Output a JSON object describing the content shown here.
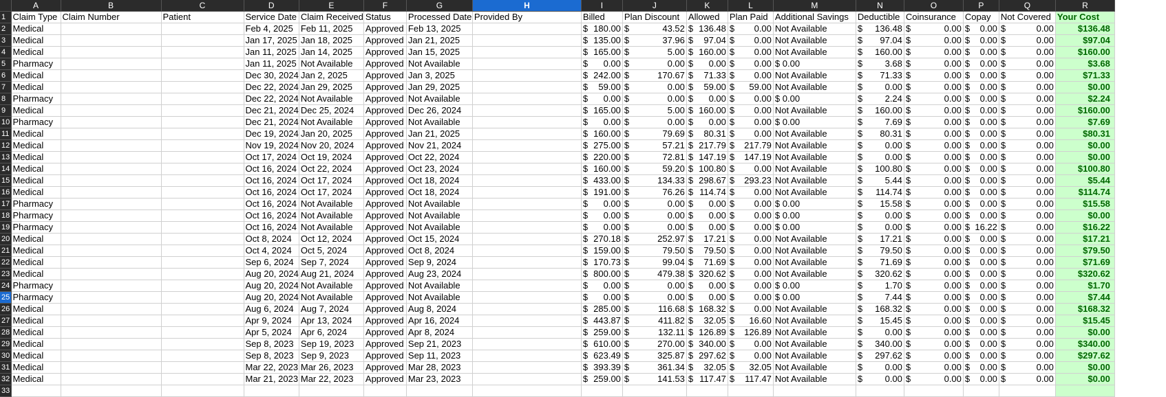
{
  "columns": [
    {
      "letter": "A",
      "header": "Claim Type"
    },
    {
      "letter": "B",
      "header": "Claim Number"
    },
    {
      "letter": "C",
      "header": "Patient"
    },
    {
      "letter": "D",
      "header": "Service Date"
    },
    {
      "letter": "E",
      "header": "Claim Received"
    },
    {
      "letter": "F",
      "header": "Status"
    },
    {
      "letter": "G",
      "header": "Processed Date"
    },
    {
      "letter": "H",
      "header": "Provided By"
    },
    {
      "letter": "I",
      "header": "Billed"
    },
    {
      "letter": "J",
      "header": "Plan Discount"
    },
    {
      "letter": "K",
      "header": "Allowed"
    },
    {
      "letter": "L",
      "header": "Plan Paid"
    },
    {
      "letter": "M",
      "header": "Additional Savings"
    },
    {
      "letter": "N",
      "header": "Deductible"
    },
    {
      "letter": "O",
      "header": "Coinsurance"
    },
    {
      "letter": "P",
      "header": "Copay"
    },
    {
      "letter": "Q",
      "header": "Not Covered"
    },
    {
      "letter": "R",
      "header": "Your Cost"
    }
  ],
  "selected_column": "H",
  "currency_symbol": "$",
  "rows": [
    [
      "2",
      "Medical",
      "",
      "",
      "Feb 4, 2025",
      "Feb 11, 2025",
      "Approved",
      "Feb 13, 2025",
      "",
      "180.00",
      "43.52",
      "136.48",
      "0.00",
      "Not Available",
      "136.48",
      "0.00",
      "0.00",
      "0.00",
      "$136.48"
    ],
    [
      "3",
      "Medical",
      "",
      "",
      "Jan 17, 2025",
      "Jan 18, 2025",
      "Approved",
      "Jan 21, 2025",
      "",
      "135.00",
      "37.96",
      "97.04",
      "0.00",
      "Not Available",
      "97.04",
      "0.00",
      "0.00",
      "0.00",
      "$97.04"
    ],
    [
      "4",
      "Medical",
      "",
      "",
      "Jan 11, 2025",
      "Jan 14, 2025",
      "Approved",
      "Jan 15, 2025",
      "",
      "165.00",
      "5.00",
      "160.00",
      "0.00",
      "Not Available",
      "160.00",
      "0.00",
      "0.00",
      "0.00",
      "$160.00"
    ],
    [
      "5",
      "Pharmacy",
      "",
      "",
      "Jan 11, 2025",
      "Not Available",
      "Approved",
      "Not Available",
      "",
      "0.00",
      "0.00",
      "0.00",
      "0.00",
      "$ 0.00",
      "3.68",
      "0.00",
      "0.00",
      "0.00",
      "$3.68"
    ],
    [
      "6",
      "Medical",
      "",
      "",
      "Dec 30, 2024",
      "Jan 2, 2025",
      "Approved",
      "Jan 3, 2025",
      "",
      "242.00",
      "170.67",
      "71.33",
      "0.00",
      "Not Available",
      "71.33",
      "0.00",
      "0.00",
      "0.00",
      "$71.33"
    ],
    [
      "7",
      "Medical",
      "",
      "",
      "Dec 22, 2024",
      "Jan 29, 2025",
      "Approved",
      "Jan 29, 2025",
      "",
      "59.00",
      "0.00",
      "59.00",
      "59.00",
      "Not Available",
      "0.00",
      "0.00",
      "0.00",
      "0.00",
      "$0.00"
    ],
    [
      "8",
      "Pharmacy",
      "",
      "",
      "Dec 22, 2024",
      "Not Available",
      "Approved",
      "Not Available",
      "",
      "0.00",
      "0.00",
      "0.00",
      "0.00",
      "$ 0.00",
      "2.24",
      "0.00",
      "0.00",
      "0.00",
      "$2.24"
    ],
    [
      "9",
      "Medical",
      "",
      "",
      "Dec 21, 2024",
      "Dec 25, 2024",
      "Approved",
      "Dec 26, 2024",
      "",
      "165.00",
      "5.00",
      "160.00",
      "0.00",
      "Not Available",
      "160.00",
      "0.00",
      "0.00",
      "0.00",
      "$160.00"
    ],
    [
      "10",
      "Pharmacy",
      "",
      "",
      "Dec 21, 2024",
      "Not Available",
      "Approved",
      "Not Available",
      "",
      "0.00",
      "0.00",
      "0.00",
      "0.00",
      "$ 0.00",
      "7.69",
      "0.00",
      "0.00",
      "0.00",
      "$7.69"
    ],
    [
      "11",
      "Medical",
      "",
      "",
      "Dec 19, 2024",
      "Jan 20, 2025",
      "Approved",
      "Jan 21, 2025",
      "",
      "160.00",
      "79.69",
      "80.31",
      "0.00",
      "Not Available",
      "80.31",
      "0.00",
      "0.00",
      "0.00",
      "$80.31"
    ],
    [
      "12",
      "Medical",
      "",
      "",
      "Nov 19, 2024",
      "Nov 20, 2024",
      "Approved",
      "Nov 21, 2024",
      "",
      "275.00",
      "57.21",
      "217.79",
      "217.79",
      "Not Available",
      "0.00",
      "0.00",
      "0.00",
      "0.00",
      "$0.00"
    ],
    [
      "13",
      "Medical",
      "",
      "",
      "Oct 17, 2024",
      "Oct 19, 2024",
      "Approved",
      "Oct 22, 2024",
      "",
      "220.00",
      "72.81",
      "147.19",
      "147.19",
      "Not Available",
      "0.00",
      "0.00",
      "0.00",
      "0.00",
      "$0.00"
    ],
    [
      "14",
      "Medical",
      "",
      "",
      "Oct 16, 2024",
      "Oct 22, 2024",
      "Approved",
      "Oct 23, 2024",
      "",
      "160.00",
      "59.20",
      "100.80",
      "0.00",
      "Not Available",
      "100.80",
      "0.00",
      "0.00",
      "0.00",
      "$100.80"
    ],
    [
      "15",
      "Medical",
      "",
      "",
      "Oct 16, 2024",
      "Oct 17, 2024",
      "Approved",
      "Oct 18, 2024",
      "",
      "433.00",
      "134.33",
      "298.67",
      "293.23",
      "Not Available",
      "5.44",
      "0.00",
      "0.00",
      "0.00",
      "$5.44"
    ],
    [
      "16",
      "Medical",
      "",
      "",
      "Oct 16, 2024",
      "Oct 17, 2024",
      "Approved",
      "Oct 18, 2024",
      "",
      "191.00",
      "76.26",
      "114.74",
      "0.00",
      "Not Available",
      "114.74",
      "0.00",
      "0.00",
      "0.00",
      "$114.74"
    ],
    [
      "17",
      "Pharmacy",
      "",
      "",
      "Oct 16, 2024",
      "Not Available",
      "Approved",
      "Not Available",
      "",
      "0.00",
      "0.00",
      "0.00",
      "0.00",
      "$ 0.00",
      "15.58",
      "0.00",
      "0.00",
      "0.00",
      "$15.58"
    ],
    [
      "18",
      "Pharmacy",
      "",
      "",
      "Oct 16, 2024",
      "Not Available",
      "Approved",
      "Not Available",
      "",
      "0.00",
      "0.00",
      "0.00",
      "0.00",
      "$ 0.00",
      "0.00",
      "0.00",
      "0.00",
      "0.00",
      "$0.00"
    ],
    [
      "19",
      "Pharmacy",
      "",
      "",
      "Oct 16, 2024",
      "Not Available",
      "Approved",
      "Not Available",
      "",
      "0.00",
      "0.00",
      "0.00",
      "0.00",
      "$ 0.00",
      "0.00",
      "0.00",
      "16.22",
      "0.00",
      "$16.22"
    ],
    [
      "20",
      "Medical",
      "",
      "",
      "Oct 8, 2024",
      "Oct 12, 2024",
      "Approved",
      "Oct 15, 2024",
      "",
      "270.18",
      "252.97",
      "17.21",
      "0.00",
      "Not Available",
      "17.21",
      "0.00",
      "0.00",
      "0.00",
      "$17.21"
    ],
    [
      "21",
      "Medical",
      "",
      "",
      "Oct 4, 2024",
      "Oct 5, 2024",
      "Approved",
      "Oct 8, 2024",
      "",
      "159.00",
      "79.50",
      "79.50",
      "0.00",
      "Not Available",
      "79.50",
      "0.00",
      "0.00",
      "0.00",
      "$79.50"
    ],
    [
      "22",
      "Medical",
      "",
      "",
      "Sep 6, 2024",
      "Sep 7, 2024",
      "Approved",
      "Sep 9, 2024",
      "",
      "170.73",
      "99.04",
      "71.69",
      "0.00",
      "Not Available",
      "71.69",
      "0.00",
      "0.00",
      "0.00",
      "$71.69"
    ],
    [
      "23",
      "Medical",
      "",
      "",
      "Aug 20, 2024",
      "Aug 21, 2024",
      "Approved",
      "Aug 23, 2024",
      "",
      "800.00",
      "479.38",
      "320.62",
      "0.00",
      "Not Available",
      "320.62",
      "0.00",
      "0.00",
      "0.00",
      "$320.62"
    ],
    [
      "24",
      "Pharmacy",
      "",
      "",
      "Aug 20, 2024",
      "Not Available",
      "Approved",
      "Not Available",
      "",
      "0.00",
      "0.00",
      "0.00",
      "0.00",
      "$ 0.00",
      "1.70",
      "0.00",
      "0.00",
      "0.00",
      "$1.70"
    ],
    [
      "25",
      "Pharmacy",
      "",
      "",
      "Aug 20, 2024",
      "Not Available",
      "Approved",
      "Not Available",
      "",
      "0.00",
      "0.00",
      "0.00",
      "0.00",
      "$ 0.00",
      "7.44",
      "0.00",
      "0.00",
      "0.00",
      "$7.44"
    ],
    [
      "26",
      "Medical",
      "",
      "",
      "Aug 6, 2024",
      "Aug 7, 2024",
      "Approved",
      "Aug 8, 2024",
      "",
      "285.00",
      "116.68",
      "168.32",
      "0.00",
      "Not Available",
      "168.32",
      "0.00",
      "0.00",
      "0.00",
      "$168.32"
    ],
    [
      "27",
      "Medical",
      "",
      "",
      "Apr 9, 2024",
      "Apr 13, 2024",
      "Approved",
      "Apr 16, 2024",
      "",
      "443.87",
      "411.82",
      "32.05",
      "16.60",
      "Not Available",
      "15.45",
      "0.00",
      "0.00",
      "0.00",
      "$15.45"
    ],
    [
      "28",
      "Medical",
      "",
      "",
      "Apr 5, 2024",
      "Apr 6, 2024",
      "Approved",
      "Apr 8, 2024",
      "",
      "259.00",
      "132.11",
      "126.89",
      "126.89",
      "Not Available",
      "0.00",
      "0.00",
      "0.00",
      "0.00",
      "$0.00"
    ],
    [
      "29",
      "Medical",
      "",
      "",
      "Sep 8, 2023",
      "Sep 19, 2023",
      "Approved",
      "Sep 21, 2023",
      "",
      "610.00",
      "270.00",
      "340.00",
      "0.00",
      "Not Available",
      "340.00",
      "0.00",
      "0.00",
      "0.00",
      "$340.00"
    ],
    [
      "30",
      "Medical",
      "",
      "",
      "Sep 8, 2023",
      "Sep 9, 2023",
      "Approved",
      "Sep 11, 2023",
      "",
      "623.49",
      "325.87",
      "297.62",
      "0.00",
      "Not Available",
      "297.62",
      "0.00",
      "0.00",
      "0.00",
      "$297.62"
    ],
    [
      "31",
      "Medical",
      "",
      "",
      "Mar 22, 2023",
      "Mar 26, 2023",
      "Approved",
      "Mar 28, 2023",
      "",
      "393.39",
      "361.34",
      "32.05",
      "32.05",
      "Not Available",
      "0.00",
      "0.00",
      "0.00",
      "0.00",
      "$0.00"
    ],
    [
      "32",
      "Medical",
      "",
      "",
      "Mar 21, 2023",
      "Mar 22, 2023",
      "Approved",
      "Mar 23, 2023",
      "",
      "259.00",
      "141.53",
      "117.47",
      "117.47",
      "Not Available",
      "0.00",
      "0.00",
      "0.00",
      "0.00",
      "$0.00"
    ]
  ],
  "empty_rows": [
    "1",
    "33"
  ],
  "header_row_number": "1",
  "colors": {
    "header_bg": "#2b2b2b",
    "selected": "#1b6bd1",
    "your_cost_bg": "#ccffcc",
    "your_cost_fg": "#006600"
  }
}
